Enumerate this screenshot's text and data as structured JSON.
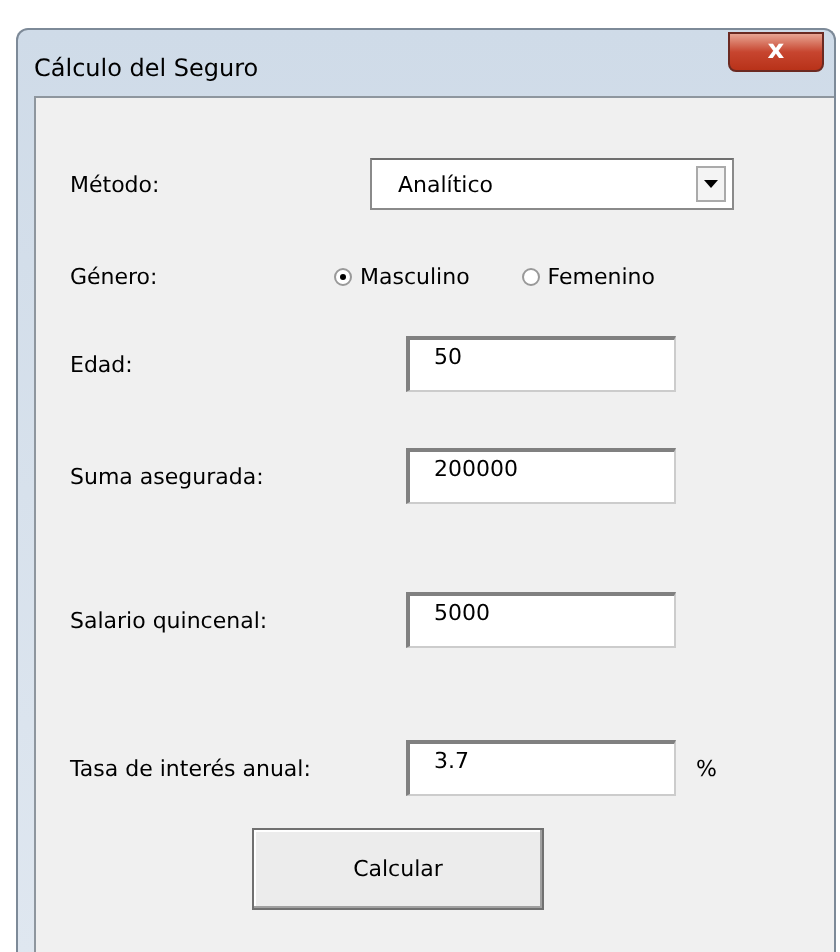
{
  "window": {
    "title": "Cálculo del Seguro",
    "close": "x"
  },
  "rows": [
    {
      "kind": "dropdown",
      "label": "Método:",
      "value": "Analítico"
    },
    {
      "kind": "radio",
      "label": "Género:",
      "options": [
        {
          "label": "Masculino",
          "selected": true
        },
        {
          "label": "Femenino",
          "selected": false
        }
      ]
    },
    {
      "kind": "text",
      "label": "Edad:",
      "value": "50"
    },
    {
      "kind": "text",
      "label": "Suma asegurada:",
      "value": "200000"
    },
    {
      "kind": "text",
      "label": "Salario quincenal:",
      "value": "5000"
    },
    {
      "kind": "text",
      "label": "Tasa de interés anual:",
      "value": "3.7",
      "unit": "%"
    }
  ],
  "button": "Calcular"
}
